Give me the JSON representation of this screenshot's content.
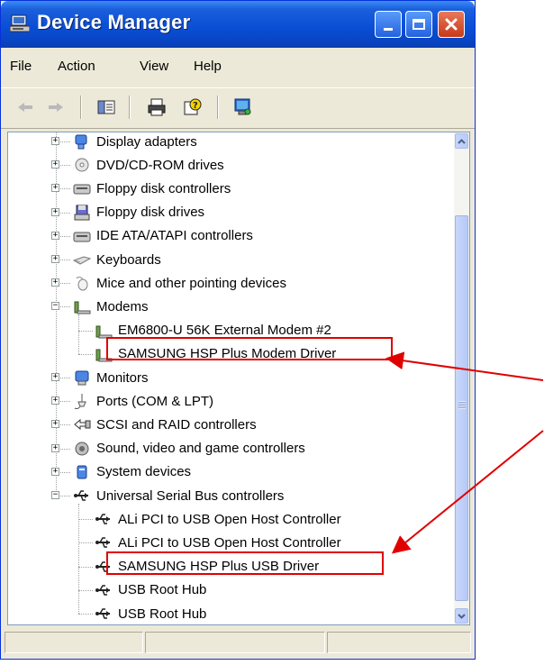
{
  "window": {
    "title": "Device Manager",
    "colors": {
      "titlebar": "#0a4fd6",
      "face": "#ece9d8",
      "annotation": "#e00000"
    }
  },
  "menu": [
    "File",
    "Action",
    "View",
    "Help"
  ],
  "toolbar": {
    "buttons": [
      "back-icon",
      "forward-icon",
      "properties-view-icon",
      "print-icon",
      "help-icon",
      "scan-hardware-icon"
    ]
  },
  "tree": {
    "categories": [
      {
        "label": "Display adapters",
        "icon": "display-adapter-icon",
        "expanded": false
      },
      {
        "label": "DVD/CD-ROM drives",
        "icon": "cdrom-icon",
        "expanded": false
      },
      {
        "label": "Floppy disk controllers",
        "icon": "floppy-controller-icon",
        "expanded": false
      },
      {
        "label": "Floppy disk drives",
        "icon": "floppy-drive-icon",
        "expanded": false
      },
      {
        "label": "IDE ATA/ATAPI controllers",
        "icon": "ide-controller-icon",
        "expanded": false
      },
      {
        "label": "Keyboards",
        "icon": "keyboard-icon",
        "expanded": false
      },
      {
        "label": "Mice and other pointing devices",
        "icon": "mouse-icon",
        "expanded": false
      },
      {
        "label": "Modems",
        "icon": "modem-icon",
        "expanded": true,
        "children": [
          "EM6800-U 56K External Modem #2",
          "SAMSUNG HSP Plus Modem Driver"
        ]
      },
      {
        "label": "Monitors",
        "icon": "monitor-icon",
        "expanded": false
      },
      {
        "label": "Ports (COM & LPT)",
        "icon": "port-icon",
        "expanded": false
      },
      {
        "label": "SCSI and RAID controllers",
        "icon": "scsi-icon",
        "expanded": false
      },
      {
        "label": "Sound, video and game controllers",
        "icon": "sound-icon",
        "expanded": false
      },
      {
        "label": "System devices",
        "icon": "system-devices-icon",
        "expanded": false
      },
      {
        "label": "Universal Serial Bus controllers",
        "icon": "usb-icon",
        "expanded": true,
        "children": [
          "ALi PCI to USB Open Host Controller",
          "ALi PCI to USB Open Host Controller",
          "SAMSUNG HSP Plus USB Driver",
          "USB Root Hub",
          "USB Root Hub"
        ]
      }
    ]
  },
  "annotations": {
    "highlighted_items": [
      "SAMSUNG HSP Plus Modem Driver",
      "SAMSUNG HSP Plus USB Driver"
    ]
  }
}
